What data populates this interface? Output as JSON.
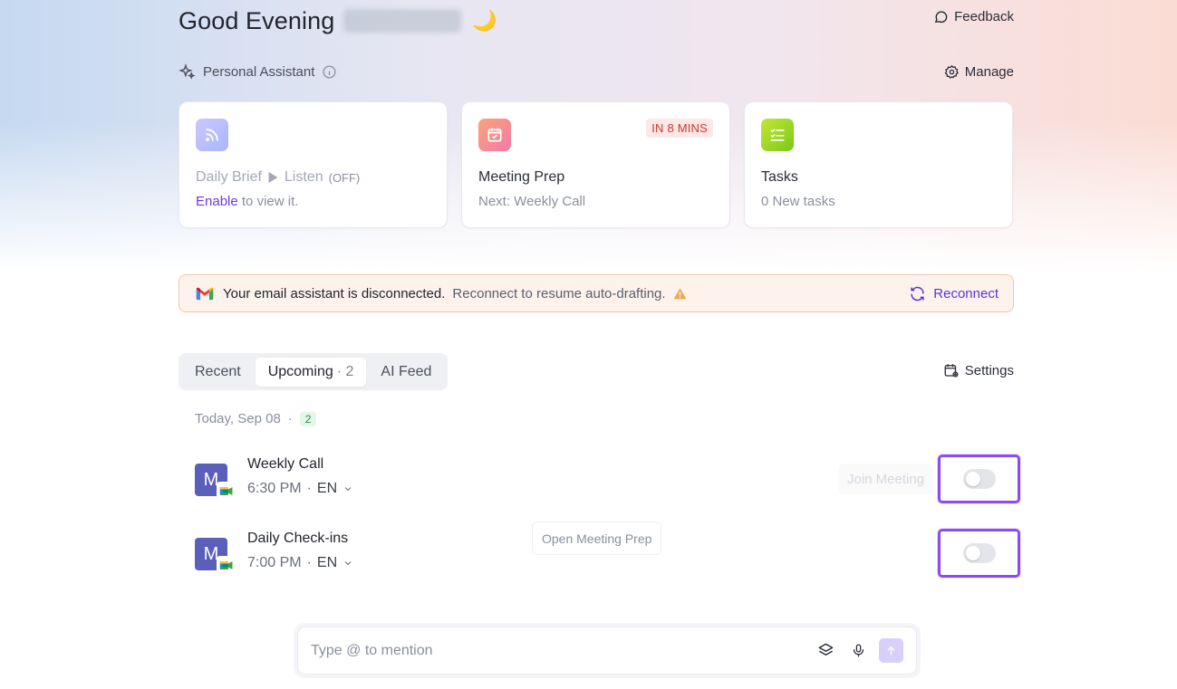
{
  "header": {
    "greeting": "Good Evening",
    "feedback_label": "Feedback"
  },
  "assistant": {
    "title": "Personal Assistant",
    "manage_label": "Manage"
  },
  "cards": {
    "brief": {
      "title": "Daily Brief",
      "listen": "Listen",
      "listen_state": "(OFF)",
      "enable": "Enable",
      "enable_rest": "to view it."
    },
    "meeting": {
      "title": "Meeting Prep",
      "badge": "IN 8 MINS",
      "sub": "Next: Weekly Call"
    },
    "tasks": {
      "title": "Tasks",
      "sub": "0 New tasks"
    }
  },
  "banner": {
    "strong": "Your email assistant is disconnected.",
    "weak": "Reconnect to resume auto-drafting.",
    "action": "Reconnect",
    "accent": "#5b35d8"
  },
  "tabs": {
    "recent": "Recent",
    "upcoming": "Upcoming",
    "upcoming_count": "· 2",
    "ai_feed": "AI Feed",
    "settings": "Settings"
  },
  "day": {
    "label": "Today, Sep 08",
    "sep": "·",
    "count": "2"
  },
  "meetings": [
    {
      "avatar": "M",
      "title": "Weekly Call",
      "time": "6:30 PM",
      "lang": "EN",
      "action": "Join Meeting"
    },
    {
      "avatar": "M",
      "title": "Daily Check-ins",
      "time": "7:00 PM",
      "lang": "EN",
      "action": "Open Meeting Prep"
    }
  ],
  "composer": {
    "placeholder": "Type @ to mention"
  }
}
